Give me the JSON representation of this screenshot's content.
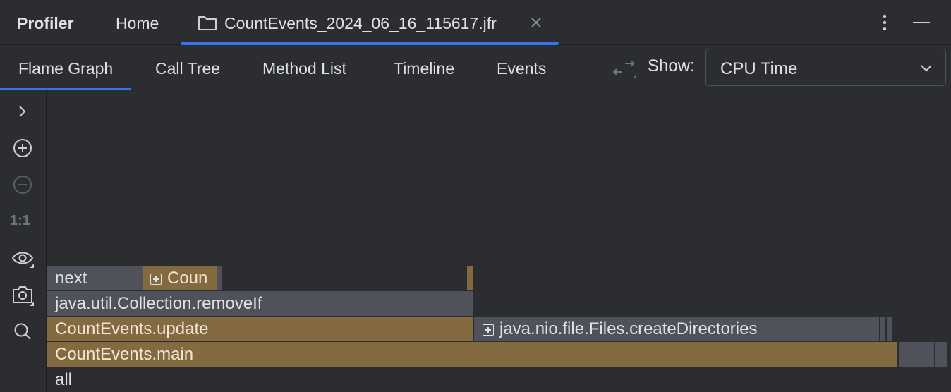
{
  "topbar": {
    "app_title": "Profiler",
    "tabs": [
      {
        "label": "Home"
      },
      {
        "label": "CountEvents_2024_06_16_115617.jfr",
        "icon": "folder-icon",
        "closable": true,
        "active": true
      }
    ]
  },
  "subtabs": [
    {
      "label": "Flame Graph",
      "active": true
    },
    {
      "label": "Call Tree"
    },
    {
      "label": "Method List"
    },
    {
      "label": "Timeline"
    },
    {
      "label": "Events"
    }
  ],
  "show": {
    "label": "Show:",
    "value": "CPU Time"
  },
  "sidebar": {
    "tools": [
      "expand-icon",
      "zoom-in-icon",
      "zoom-out-icon",
      "actual-size",
      "eye-icon",
      "camera-icon",
      "search-icon"
    ],
    "actual_size_label": "1:1"
  },
  "flame": {
    "frames": [
      {
        "label": "next"
      },
      {
        "label": "Coun",
        "expandable": true
      },
      {
        "label": "java.util.Collection.removeIf"
      },
      {
        "label": "CountEvents.update"
      },
      {
        "label": "java.nio.file.Files.createDirectories",
        "expandable": true
      },
      {
        "label": "CountEvents.main"
      },
      {
        "label": "all"
      }
    ]
  },
  "colors": {
    "accent": "#3574f0",
    "frame_gray": "#4f525a",
    "frame_ochre": "#846a40",
    "background": "#2b2d30"
  }
}
